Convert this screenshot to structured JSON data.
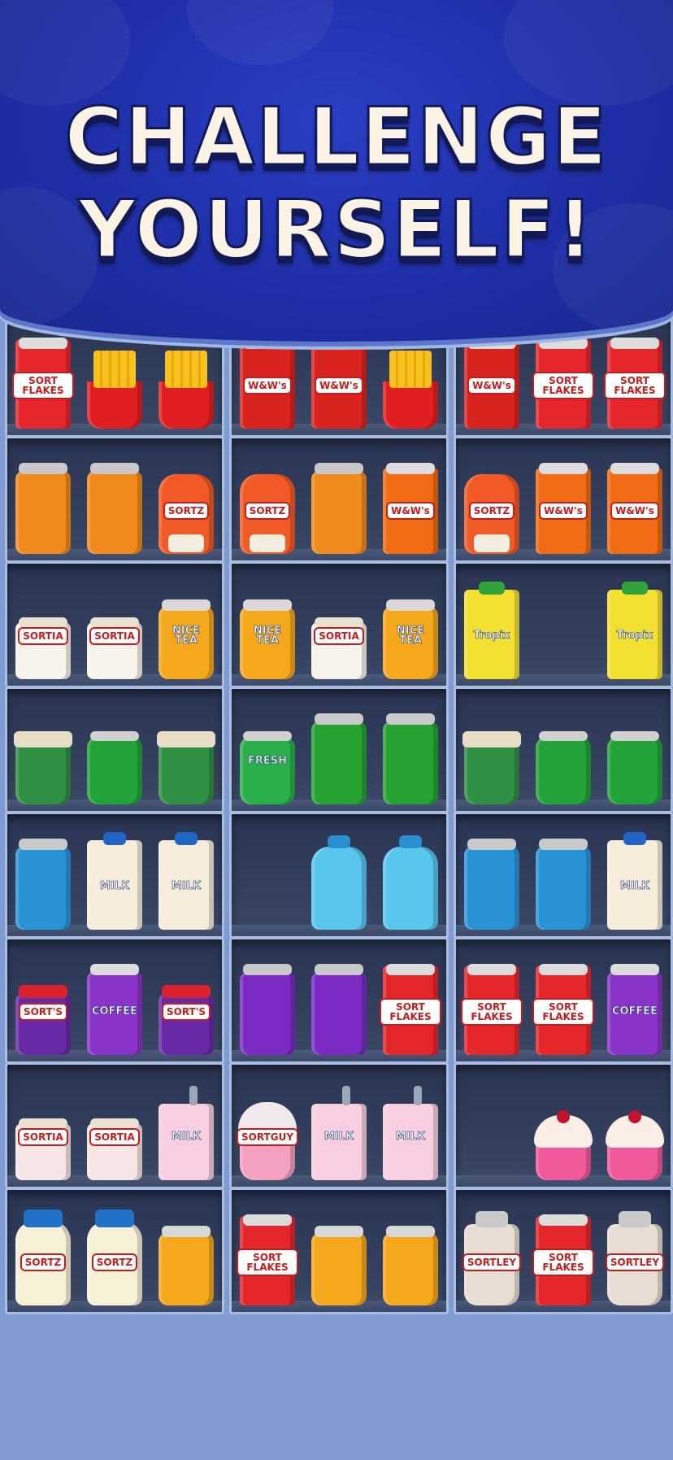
{
  "banner": {
    "line1": "CHALLENGE",
    "line2": "YOURSELF!"
  },
  "colors": {
    "banner": "#1f2fa8",
    "shelf_frame": "#a9bde3",
    "shelf_back": "#2a3553",
    "title_text": "#fbf4e6",
    "title_outline": "#121a55"
  },
  "shelves": [
    [
      [
        {
          "kind": "cereal",
          "label": "SORT FLAKES"
        },
        {
          "kind": "fries",
          "label": ""
        },
        {
          "kind": "fries",
          "label": ""
        }
      ],
      [
        {
          "kind": "candy",
          "label": "W&W's"
        },
        {
          "kind": "candy",
          "label": "W&W's"
        },
        {
          "kind": "fries",
          "label": ""
        }
      ],
      [
        {
          "kind": "candy",
          "label": "W&W's"
        },
        {
          "kind": "cereal",
          "label": "SORT FLAKES"
        },
        {
          "kind": "cereal",
          "label": "SORT FLAKES"
        }
      ]
    ],
    [
      [
        {
          "kind": "chips-orange",
          "label": ""
        },
        {
          "kind": "chips-orange",
          "label": ""
        },
        {
          "kind": "sauce",
          "label": "SORTZ"
        }
      ],
      [
        {
          "kind": "sauce",
          "label": "SORTZ"
        },
        {
          "kind": "chips-orange",
          "label": ""
        },
        {
          "kind": "candy-orange",
          "label": "W&W's"
        }
      ],
      [
        {
          "kind": "sauce",
          "label": "SORTZ"
        },
        {
          "kind": "candy-orange",
          "label": "W&W's"
        },
        {
          "kind": "candy-orange",
          "label": "W&W's"
        }
      ]
    ],
    [
      [
        {
          "kind": "yogurt",
          "label": "SORTIA"
        },
        {
          "kind": "yogurt",
          "label": "SORTIA"
        },
        {
          "kind": "jar",
          "label": "NICE TEA"
        }
      ],
      [
        {
          "kind": "jar",
          "label": "NICE TEA"
        },
        {
          "kind": "yogurt",
          "label": "SORTIA"
        },
        {
          "kind": "jar",
          "label": "NICE TEA"
        }
      ],
      [
        {
          "kind": "juice",
          "label": "Tropix"
        },
        null,
        {
          "kind": "juice",
          "label": "Tropix"
        }
      ]
    ],
    [
      [
        {
          "kind": "coffee",
          "label": ""
        },
        {
          "kind": "soda",
          "label": ""
        },
        {
          "kind": "coffee",
          "label": ""
        }
      ],
      [
        {
          "kind": "soda-blue",
          "label": "FRESH"
        },
        {
          "kind": "chips-green",
          "label": ""
        },
        {
          "kind": "chips-green",
          "label": ""
        }
      ],
      [
        {
          "kind": "coffee",
          "label": ""
        },
        {
          "kind": "soda",
          "label": ""
        },
        {
          "kind": "soda",
          "label": ""
        }
      ]
    ],
    [
      [
        {
          "kind": "chips-blue",
          "label": ""
        },
        {
          "kind": "milk",
          "label": "MILK"
        },
        {
          "kind": "milk",
          "label": "MILK"
        }
      ],
      [
        null,
        {
          "kind": "water",
          "label": ""
        },
        {
          "kind": "water",
          "label": ""
        }
      ],
      [
        {
          "kind": "chips-blue",
          "label": ""
        },
        {
          "kind": "chips-blue",
          "label": ""
        },
        {
          "kind": "milk",
          "label": "MILK"
        }
      ]
    ],
    [
      [
        {
          "kind": "jam",
          "label": "SORT'S"
        },
        {
          "kind": "coffee-bag",
          "label": "COFFEE"
        },
        {
          "kind": "jam",
          "label": "SORT'S"
        }
      ],
      [
        {
          "kind": "chips-purple",
          "label": ""
        },
        {
          "kind": "chips-purple",
          "label": ""
        },
        {
          "kind": "cereal",
          "label": "SORT FLAKES"
        }
      ],
      [
        {
          "kind": "cereal",
          "label": "SORT FLAKES"
        },
        {
          "kind": "cereal",
          "label": "SORT FLAKES"
        },
        {
          "kind": "coffee-bag",
          "label": "COFFEE"
        }
      ]
    ],
    [
      [
        {
          "kind": "yogurt-pink",
          "label": "SORTIA"
        },
        {
          "kind": "yogurt-pink",
          "label": "SORTIA"
        },
        {
          "kind": "milk-pink",
          "label": "MILK"
        }
      ],
      [
        {
          "kind": "shake",
          "label": "SORTGUY"
        },
        {
          "kind": "milk-pink",
          "label": "MILK"
        },
        {
          "kind": "milk-pink",
          "label": "MILK"
        }
      ],
      [
        null,
        {
          "kind": "cupcake",
          "label": ""
        },
        {
          "kind": "cupcake",
          "label": ""
        }
      ]
    ],
    [
      [
        {
          "kind": "mayo",
          "label": "SORTZ"
        },
        {
          "kind": "mayo",
          "label": "SORTZ"
        },
        {
          "kind": "jar",
          "label": ""
        }
      ],
      [
        {
          "kind": "cereal",
          "label": "SORT FLAKES"
        },
        {
          "kind": "jar",
          "label": ""
        },
        {
          "kind": "jar",
          "label": ""
        }
      ],
      [
        {
          "kind": "tumbler",
          "label": "SORTLEY"
        },
        {
          "kind": "cereal",
          "label": "SORT FLAKES"
        },
        {
          "kind": "tumbler",
          "label": "SORTLEY"
        }
      ]
    ]
  ]
}
